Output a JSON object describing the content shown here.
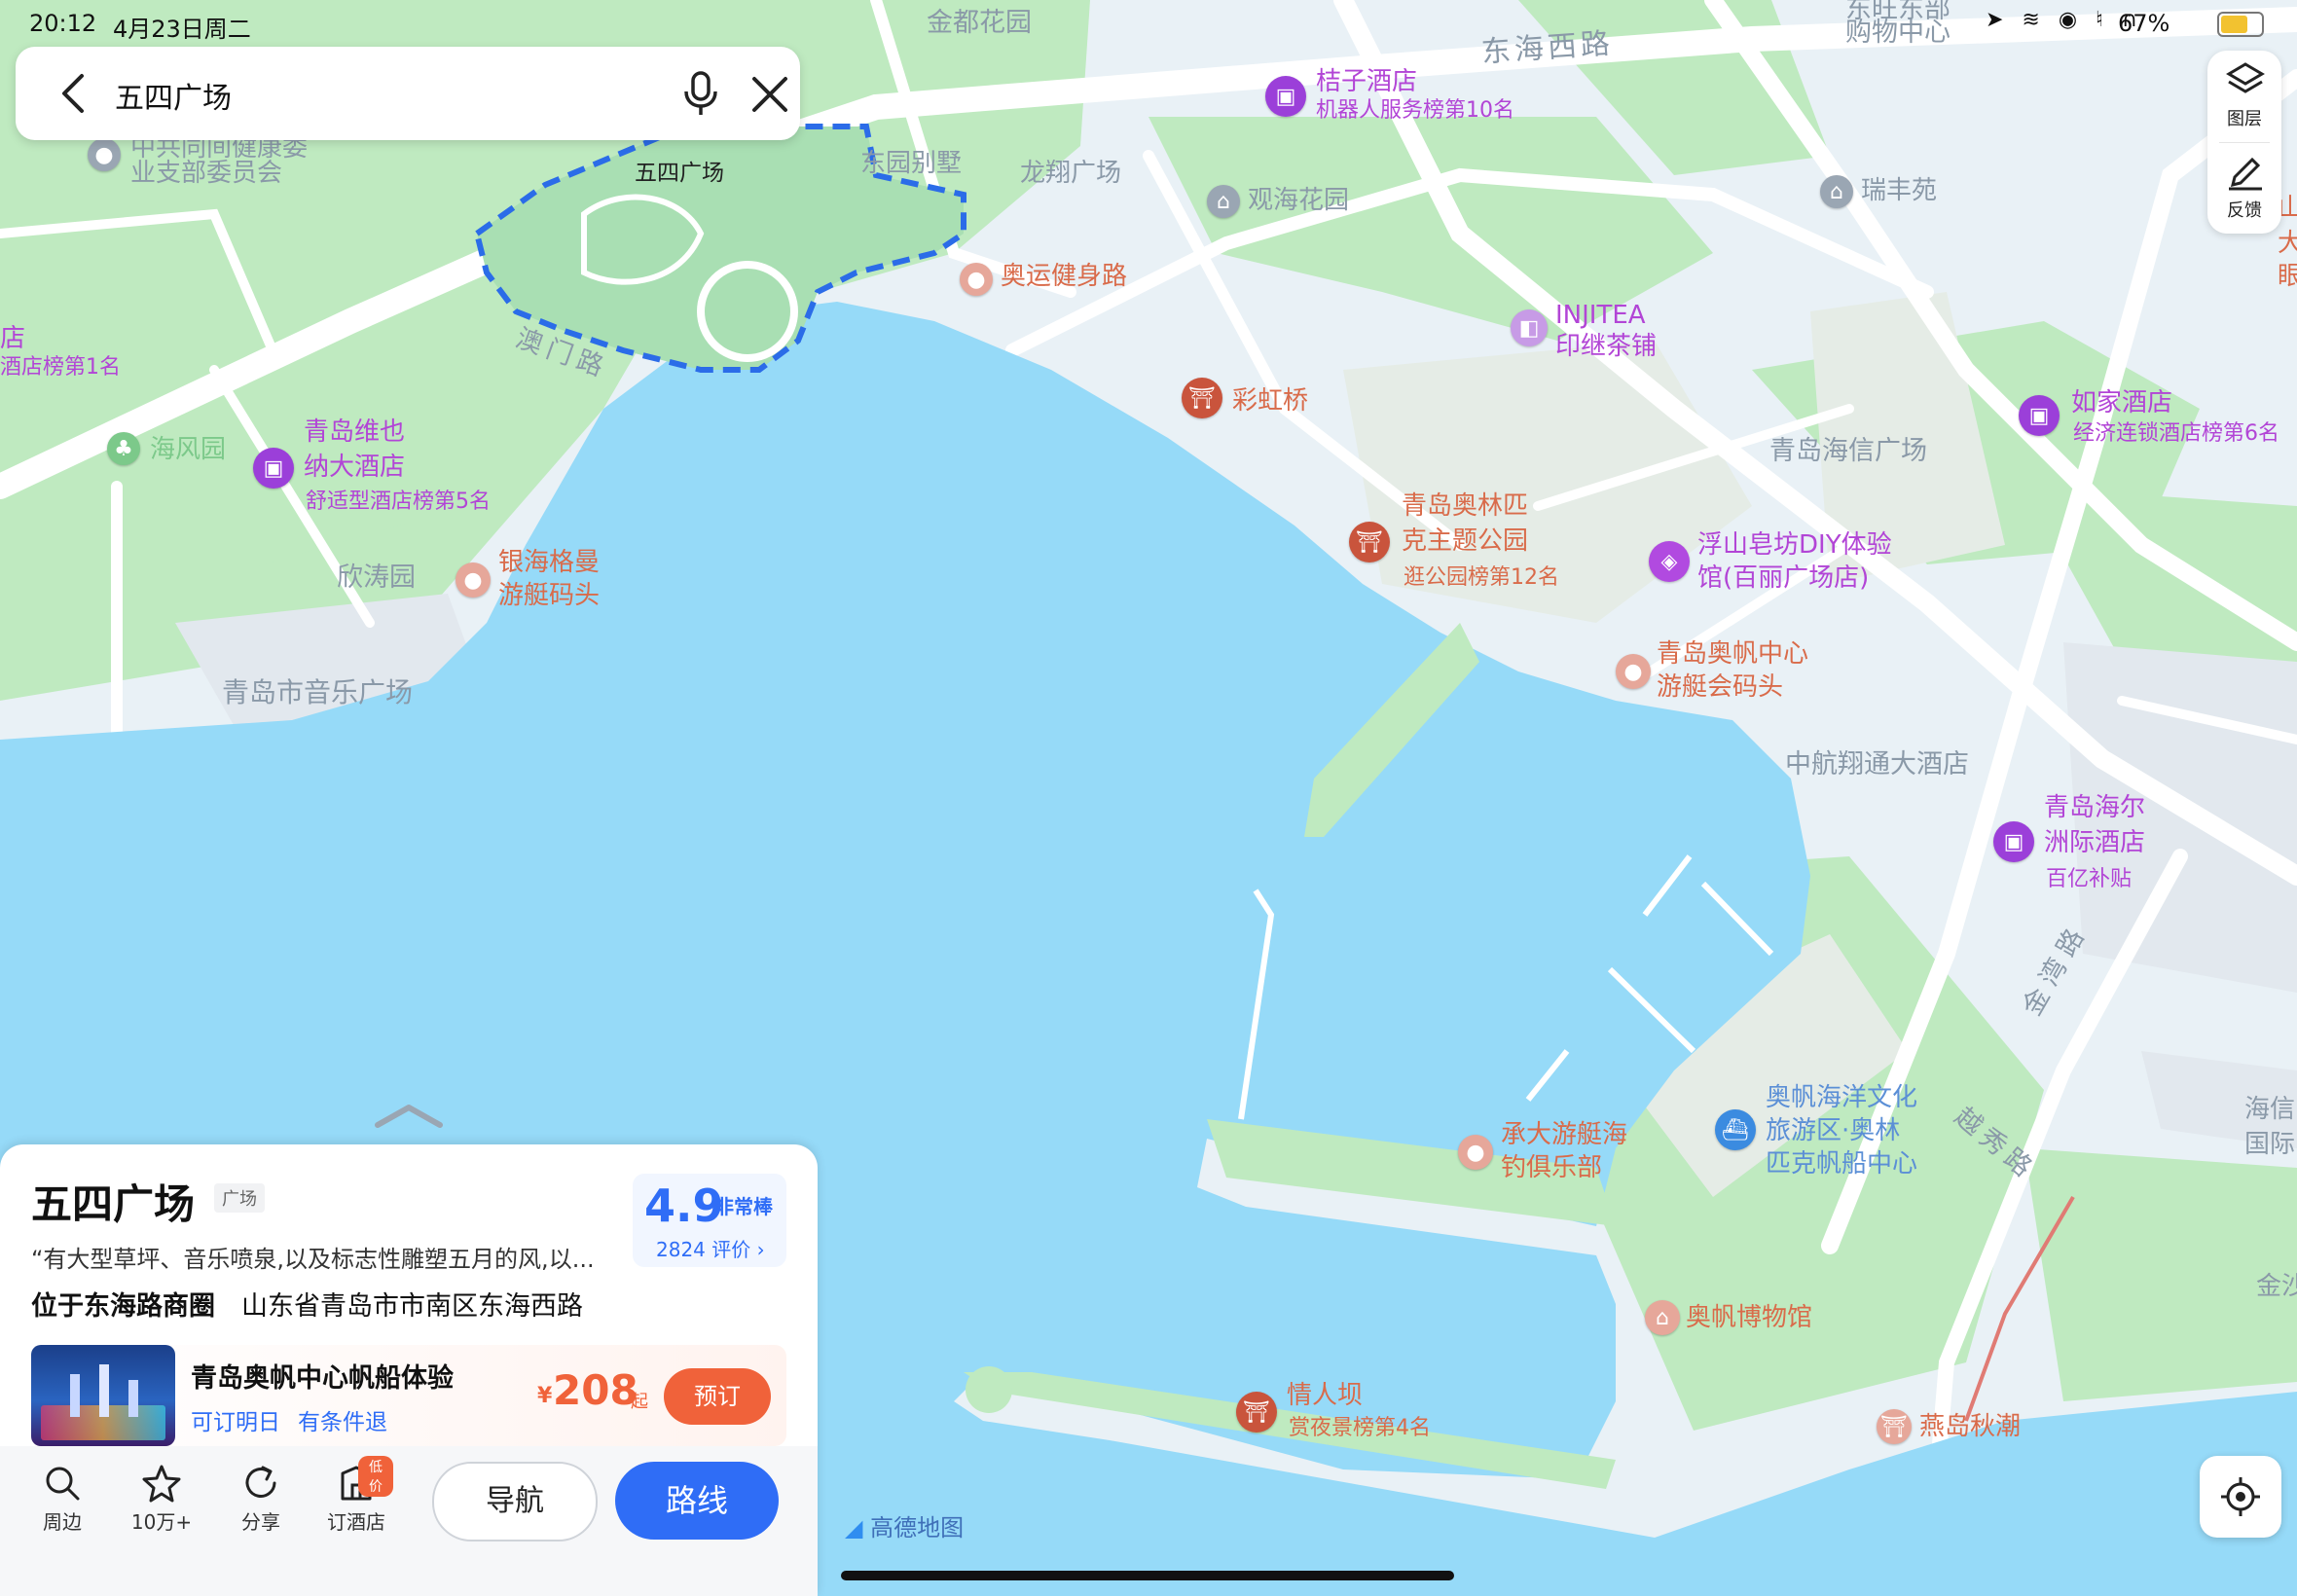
{
  "status_bar": {
    "time": "20:12",
    "date": "4月23日周二",
    "battery": "67%"
  },
  "search": {
    "query": "五四广场"
  },
  "right_buttons": {
    "layers_label": "图层",
    "feedback_label": "反馈"
  },
  "map": {
    "labels": {
      "jindu": "金都花园",
      "donghai": "东海西路",
      "jiuzi": "桔子酒店",
      "jiuzi_rank": "机器人服务榜第10名",
      "dongyuan": "东园别墅",
      "longxiang": "龙翔广场",
      "guanhai": "观海花园",
      "ruifeng": "瑞丰苑",
      "aoyun": "奥运健身路",
      "injitea": "INJITEA",
      "injitea2": "印继茶铺",
      "caihong": "彩虹桥",
      "rujia": "如家酒店",
      "rujia_rank": "经济连锁酒店榜第6名",
      "haixin": "青岛海信广场",
      "aolin1": "青岛奥林匹",
      "aolin2": "克主题公园",
      "aolin_rank": "逛公园榜第12名",
      "fushan1": "浮山皂坊DIY体验",
      "fushan2": "馆(百丽广场店)",
      "aofan1": "青岛奥帆中心",
      "aofan2": "游艇会码头",
      "zhonghang": "中航翔通大酒店",
      "haier1": "青岛海尔",
      "haier2": "洲际酒店",
      "haier_sub": "百亿补贴",
      "aomen": "澳门路",
      "wusi": "五四广场",
      "haifeng": "海风园",
      "weiye1": "青岛维也",
      "weiye2": "纳大酒店",
      "weiye_rank": "舒适型酒店榜第5名",
      "xintao": "欣涛园",
      "yinhai1": "银海格曼",
      "yinhai2": "游艇码头",
      "yinyue": "青岛市音乐广场",
      "chengda1": "承大游艇海",
      "chengda2": "钓俱乐部",
      "aofanhy1": "奥帆海洋文化",
      "aofanhy2": "旅游区·奥林",
      "aofanhy3": "匹克帆船中心",
      "yuexiu": "越秀路",
      "jinwan": "金湾路",
      "bowuguan": "奥帆博物馆",
      "qingrenba": "情人坝",
      "qingrenba_rank": "赏夜景榜第4名",
      "yandao": "燕岛秋潮",
      "tl1": "中共同间健康委",
      "tl2": "业支部委员会",
      "left_hotel": "店",
      "left_rank": "酒店榜第1名",
      "top_partial1": "东旺东部",
      "top_partial2": "购物中心",
      "edge_r1": "山",
      "edge_r2": "大",
      "edge_r3": "眼",
      "edge_r4": "海信",
      "edge_r5": "国际",
      "edge_r6": "金沙"
    },
    "logo": "高德地图"
  },
  "card": {
    "title": "五四广场",
    "tag": "广场",
    "desc": "“有大型草坪、音乐喷泉,以及标志性雕塑五月的风,以...",
    "rating": "4.9",
    "rating_word": "非常棒",
    "review_count": "2824 评价 ›",
    "location_area": "位于东海路商圈",
    "address": "山东省青岛市市南区东海西路",
    "deal": {
      "title": "青岛奥帆中心帆船体验",
      "tag1": "可订明日",
      "tag2": "有条件退",
      "price_symbol": "¥",
      "price": "208",
      "price_suffix": "起",
      "book_label": "预订"
    },
    "actions": {
      "nearby": "周边",
      "favorite": "10万+",
      "share": "分享",
      "hotel": "订酒店",
      "hotel_badge": "低价",
      "navigate": "导航",
      "route": "路线"
    }
  },
  "colors": {
    "water": "#96daf8",
    "land": "#e9f1f6",
    "green": "#bfeac0",
    "road": "#ffffff",
    "accent": "#2f6df6",
    "poi_purple": "#9b3fd9",
    "poi_red": "#c9543c",
    "label_purple": "#b245d6",
    "label_red": "#d96b4a",
    "label_gray": "#8a99a8",
    "book_orange": "#f0623a"
  },
  "icons": {
    "back": "chevron-left-icon",
    "mic": "microphone-icon",
    "clear": "close-icon",
    "layers": "layers-icon",
    "feedback": "pencil-icon",
    "locate": "locate-icon",
    "nearby": "search-icon",
    "favorite": "star-icon",
    "share": "share-icon",
    "hotel": "hotel-icon"
  }
}
